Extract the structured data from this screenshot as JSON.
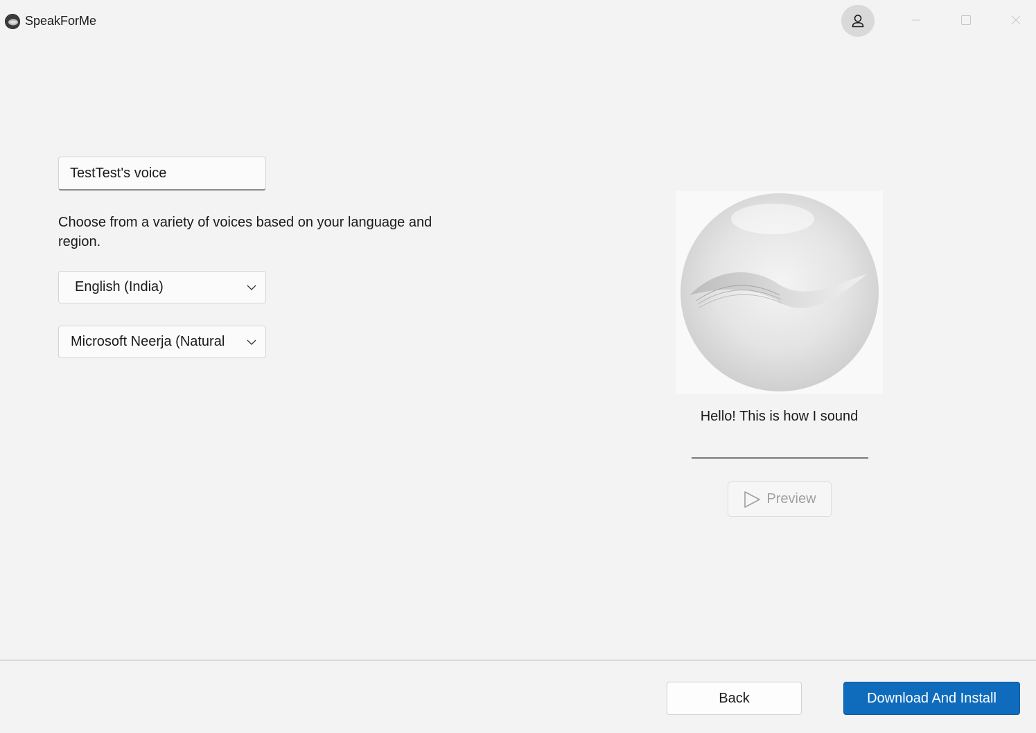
{
  "app": {
    "title": "SpeakForMe",
    "icon": "speakforme-logo-icon",
    "account_icon": "person-icon",
    "window_controls": [
      "minimize-icon",
      "maximize-icon",
      "close-icon"
    ]
  },
  "form": {
    "voice_name": "TestTest's voice",
    "description": "Choose from a variety of voices based on your language and region.",
    "language": "English (India)",
    "voice": "Microsoft Neerja (Natural",
    "dropdown_icon": "chevron-down-icon"
  },
  "preview": {
    "image": "voice-orb-image",
    "sample_text": "Hello! This is how I sound",
    "button_label": "Preview",
    "button_icon": "play-icon"
  },
  "footer": {
    "back_label": "Back",
    "install_label": "Download And Install",
    "accent_color": "#0f6cbd"
  }
}
